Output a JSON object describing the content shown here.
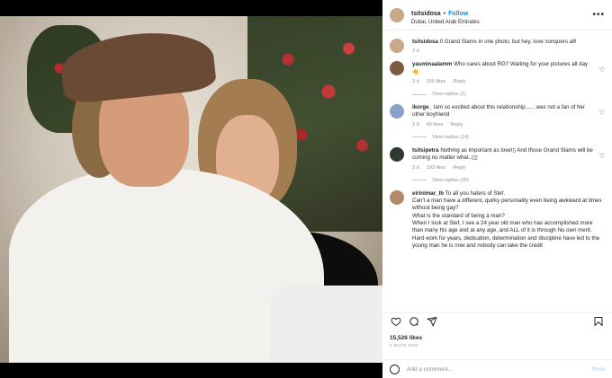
{
  "post": {
    "username": "tsitsidosa",
    "follow_label": "Follow",
    "location": "Dubai, United Arab Emirates",
    "more_icon": "more-options-icon"
  },
  "comments": [
    {
      "user": "tsitsidosa",
      "text": "0 Grand Slams in one photo, but hey, love conquers all!",
      "age": "2 d",
      "likes": "",
      "reply": "",
      "view_replies": "",
      "avatar_color": "#c9a789"
    },
    {
      "user": "yasminaalamm",
      "text": "Who cares about RG? Waiting for your pictures all day 👏",
      "age": "2 d",
      "likes": "155 likes",
      "reply": "Reply",
      "view_replies": "View replies (1)",
      "avatar_color": "#7d5a44"
    },
    {
      "user": "ikorge_",
      "text": "Iam so excited about this relationship...... was not a fan of her other boyfriend",
      "age": "2 d",
      "likes": "40 likes",
      "reply": "Reply",
      "view_replies": "View replies (14)",
      "avatar_color": "#8aa0c8"
    },
    {
      "user": "tsitsipetra",
      "text": "Nothing as important as love!▯ And those Grand Slams will be coming no matter what..▯▯",
      "age": "2 d",
      "likes": "193 likes",
      "reply": "Reply",
      "view_replies": "View replies (30)",
      "avatar_color": "#2f3a2f"
    },
    {
      "user": "eirinimar_lb",
      "text": "To all you haters of Stef.\nCan't a man have a different, quirky personality even being awkward at times without being gay?\nWhat is the standard of being a man?\nWhen I look at Stef, I see a 24 year old man who has accomplished more than many his age and at any age, and ALL of it is through his own merit. Hard work for years, dedication, determination and discipline have led to the young man he is now and nobody can take the credit",
      "age": "",
      "likes": "",
      "reply": "",
      "view_replies": "",
      "avatar_color": "#b08a6a"
    }
  ],
  "actions": {
    "like_icon": "heart-icon",
    "comment_icon": "comment-icon",
    "share_icon": "share-icon",
    "save_icon": "bookmark-icon"
  },
  "likes_count": "15,526 likes",
  "posted_date": "2 DAYS AGO",
  "add_comment": {
    "placeholder": "Add a comment...",
    "post_label": "Post"
  },
  "colors": {
    "follow": "#0095f6",
    "post_disabled": "#b3dbff",
    "muted": "#8e8e8e"
  }
}
